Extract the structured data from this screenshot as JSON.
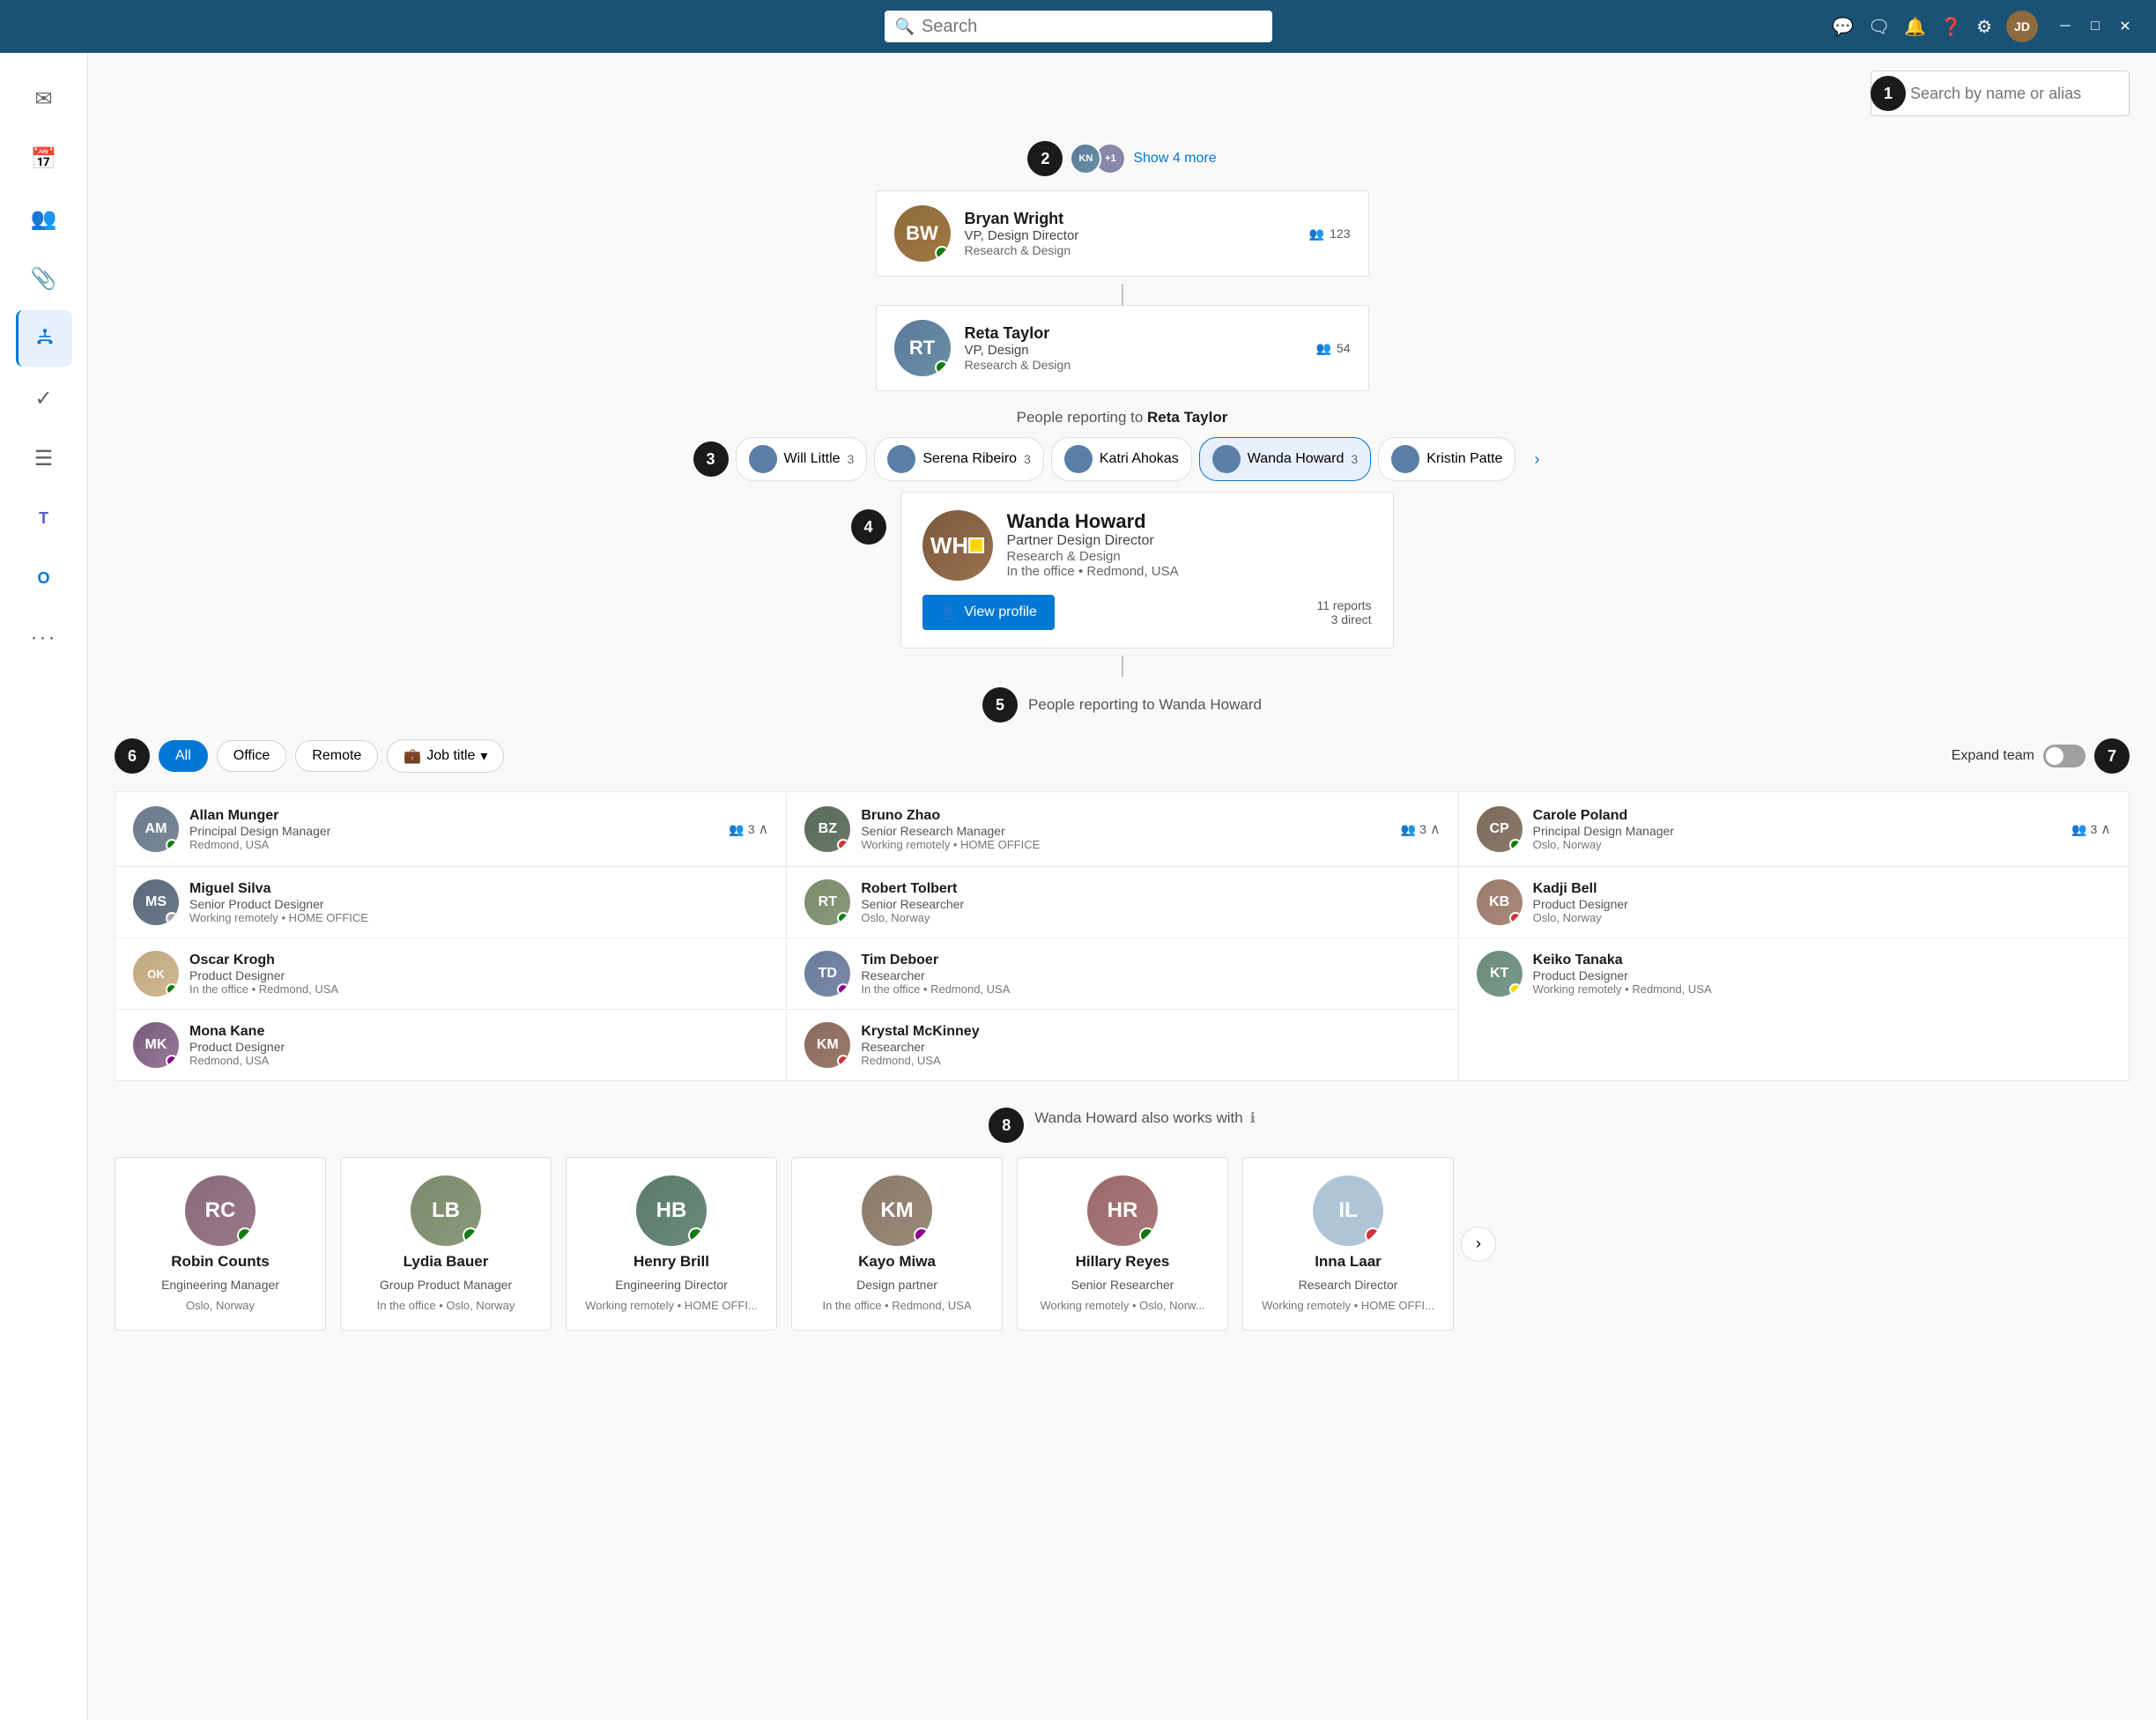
{
  "titlebar": {
    "search_placeholder": "Search",
    "icons": [
      "chat-icon",
      "comment-icon",
      "bell-icon",
      "help-icon",
      "settings-icon"
    ],
    "avatar_initials": "JD",
    "window_controls": [
      "minimize",
      "maximize",
      "close"
    ]
  },
  "sidebar": {
    "items": [
      {
        "id": "mail",
        "icon": "✉",
        "label": "Mail",
        "active": false
      },
      {
        "id": "calendar",
        "icon": "📅",
        "label": "Calendar",
        "active": false
      },
      {
        "id": "people",
        "icon": "👥",
        "label": "People",
        "active": false
      },
      {
        "id": "attach",
        "icon": "📎",
        "label": "Attachments",
        "active": false
      },
      {
        "id": "org",
        "icon": "🏢",
        "label": "Org",
        "active": true
      },
      {
        "id": "check",
        "icon": "✓",
        "label": "Tasks",
        "active": false
      },
      {
        "id": "list",
        "icon": "☰",
        "label": "Lists",
        "active": false
      },
      {
        "id": "teams",
        "icon": "T",
        "label": "Teams",
        "active": false
      },
      {
        "id": "outlook",
        "icon": "O",
        "label": "Outlook",
        "active": false
      },
      {
        "id": "more",
        "icon": "···",
        "label": "More",
        "active": false
      }
    ]
  },
  "top_search": {
    "placeholder": "Search by name or alias",
    "label_number": "1"
  },
  "show_more": {
    "label": "Show 4 more",
    "plus": "+1"
  },
  "people": {
    "bryan": {
      "name": "Bryan Wright",
      "title": "VP, Design Director",
      "dept": "Research & Design",
      "reports": "123",
      "status": "green"
    },
    "reta": {
      "name": "Reta Taylor",
      "title": "VP, Design",
      "dept": "Research & Design",
      "reports": "54",
      "status": "green"
    }
  },
  "reporting_to_reta": "People reporting to Reta Taylor",
  "reporting_chips": [
    {
      "name": "Will Little",
      "count": "3",
      "active": false
    },
    {
      "name": "Serena Ribeiro",
      "count": "3",
      "active": false
    },
    {
      "name": "Katri Ahokas",
      "count": "",
      "active": true
    },
    {
      "name": "Wanda Howard",
      "count": "3",
      "active": true
    },
    {
      "name": "Kristin Patte",
      "count": "",
      "active": false
    }
  ],
  "wanda": {
    "name": "Wanda Howard",
    "title": "Partner Design Director",
    "dept": "Research & Design",
    "location": "In the office • Redmond, USA",
    "view_profile": "View profile",
    "reports_total": "11 reports",
    "reports_direct": "3 direct",
    "status": "yellow"
  },
  "reporting_to_wanda": "People reporting to Wanda Howard",
  "annotation_numbers": [
    "2",
    "3",
    "4",
    "5",
    "6",
    "7",
    "8"
  ],
  "filters": {
    "all": "All",
    "office": "Office",
    "remote": "Remote",
    "job_title": "Job title",
    "expand_team": "Expand team"
  },
  "team_columns": [
    {
      "header": {
        "name": "Allan Munger",
        "title": "Principal Design Manager",
        "location": "Redmond, USA",
        "reports": "3",
        "status": "green"
      },
      "members": [
        {
          "name": "Miguel Silva",
          "title": "Senior Product Designer",
          "location": "Working remotely • HOME OFFICE",
          "status": "none"
        },
        {
          "name": "Oscar Krogh",
          "title": "Product Designer",
          "location": "In the office • Redmond, USA",
          "status": "green",
          "initials": "OK"
        },
        {
          "name": "Mona Kane",
          "title": "Product Designer",
          "location": "Redmond, USA",
          "status": "purple"
        }
      ]
    },
    {
      "header": {
        "name": "Bruno Zhao",
        "title": "Senior Research Manager",
        "location": "Working remotely • HOME OFFICE",
        "reports": "3",
        "status": "red"
      },
      "members": [
        {
          "name": "Robert Tolbert",
          "title": "Senior Researcher",
          "location": "Oslo, Norway",
          "status": "green"
        },
        {
          "name": "Tim Deboer",
          "title": "Researcher",
          "location": "In the office • Redmond, USA",
          "status": "purple"
        },
        {
          "name": "Krystal McKinney",
          "title": "Researcher",
          "location": "Redmond, USA",
          "status": "red"
        }
      ]
    },
    {
      "header": {
        "name": "Carole Poland",
        "title": "Principal Design Manager",
        "location": "Oslo, Norway",
        "reports": "3",
        "status": "green"
      },
      "members": [
        {
          "name": "Kadji Bell",
          "title": "Product Designer",
          "location": "Oslo, Norway",
          "status": "red"
        },
        {
          "name": "Keiko Tanaka",
          "title": "Product Designer",
          "location": "Working remotely • Redmond, USA",
          "status": "yellow"
        }
      ]
    }
  ],
  "also_works_with": {
    "label": "Wanda Howard also works with",
    "info_icon": "ℹ",
    "people": [
      {
        "name": "Robin Counts",
        "title": "Engineering Manager",
        "location": "Oslo, Norway",
        "status": "green",
        "initials": "RC"
      },
      {
        "name": "Lydia Bauer",
        "title": "Group Product Manager",
        "location": "In the office • Oslo, Norway",
        "status": "green",
        "initials": "LB"
      },
      {
        "name": "Henry Brill",
        "title": "Engineering Director",
        "location": "Working remotely • HOME OFFI...",
        "status": "green",
        "initials": "HB"
      },
      {
        "name": "Kayo Miwa",
        "title": "Design partner",
        "location": "In the office • Redmond, USA",
        "status": "purple",
        "initials": "KM"
      },
      {
        "name": "Hillary Reyes",
        "title": "Senior Researcher",
        "location": "Working remotely • Oslo, Norw...",
        "status": "green",
        "initials": "HR"
      },
      {
        "name": "Inna Laar",
        "title": "Research Director",
        "location": "Working remotely • HOME OFFI...",
        "status": "red",
        "initials": "IL"
      }
    ],
    "next_label": "›"
  }
}
